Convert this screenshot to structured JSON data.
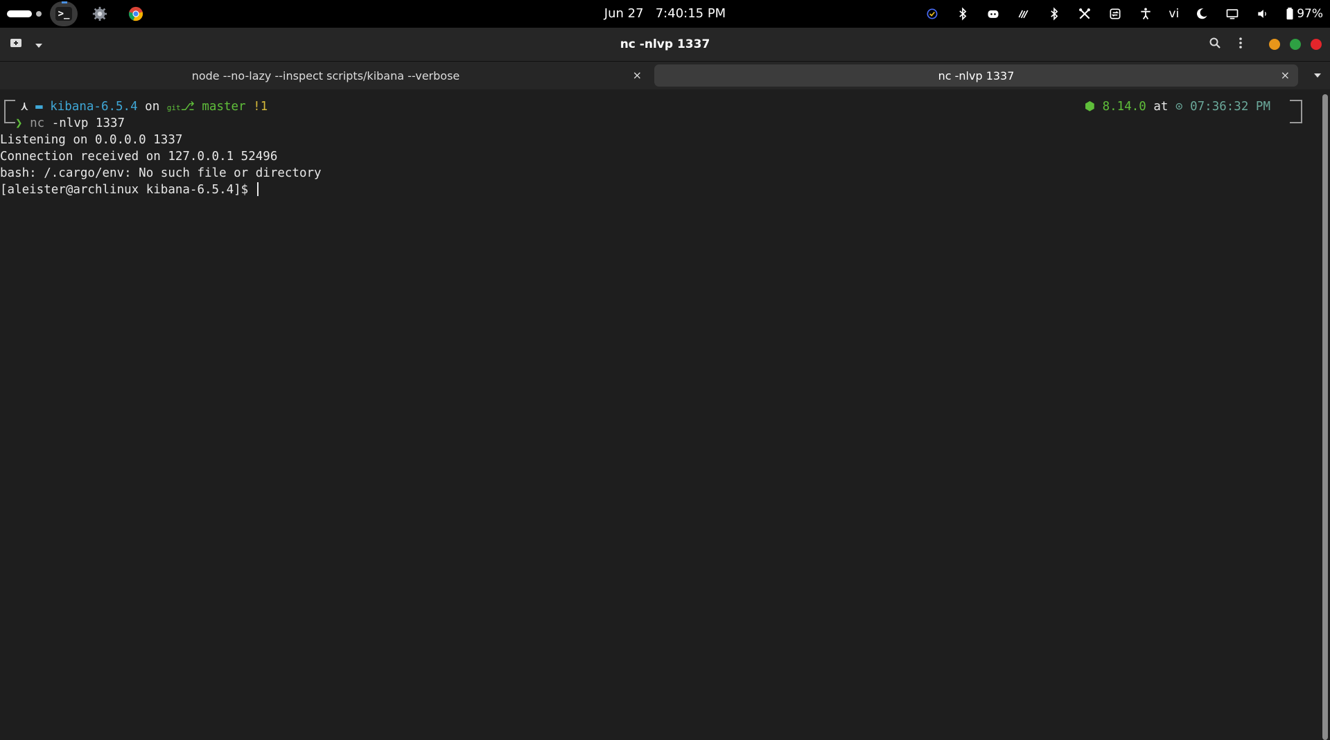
{
  "topbar": {
    "date": "Jun 27",
    "time": "7:40:15 PM",
    "keyboard_layout": "vi",
    "battery": "97%",
    "dock": [
      "terminal-icon",
      "settings-icon",
      "chrome-icon"
    ],
    "terminal_glyph": ">_",
    "tray_icons": [
      "check-circle-icon",
      "bluetooth-icon",
      "discord-icon",
      "wave-icon",
      "bluetooth-icon",
      "tools-icon",
      "sync-icon",
      "accessibility-icon",
      "keyboard-layout-indicator",
      "night-light-icon",
      "display-icon",
      "volume-icon",
      "battery-icon"
    ]
  },
  "window": {
    "title": "nc -nlvp 1337"
  },
  "tabs": [
    {
      "label": "node --no-lazy --inspect scripts/kibana --verbose",
      "close": "×"
    },
    {
      "label": "nc -nlvp 1337",
      "close": "×",
      "active": true
    }
  ],
  "terminal": {
    "prompt": {
      "arch_glyph": "⋏",
      "folder_glyph": "▬",
      "directory": "kibana-6.5.4",
      "on_word": "on",
      "git_label": "git",
      "branch_glyph": "⎇",
      "branch": "master",
      "git_status": "!1",
      "node_glyph": "⬢",
      "node_version": "8.14.0",
      "at_word": "at",
      "clock_glyph": "⊙",
      "time": "07:36:32 PM",
      "arrow": "❯",
      "cmd": "nc",
      "args": " -nlvp 1337"
    },
    "output": [
      "Listening on 0.0.0.0 1337",
      "Connection received on 127.0.0.1 52496",
      "bash: /.cargo/env: No such file or directory"
    ],
    "shell_prompt": "[aleister@archlinux kibana-6.5.4]$ "
  },
  "colors": {
    "topbar": "#000000",
    "header": "#262626",
    "background": "#1e1e1e",
    "active_tab": "#3c3c3c",
    "minimize": "#e8961a",
    "maximize": "#2ea043",
    "close": "#e5252b",
    "dir_blue": "#3fa7d6",
    "git_green": "#5fbe3a",
    "status_yellow": "#d4b83a",
    "time_teal": "#6aa89a"
  }
}
